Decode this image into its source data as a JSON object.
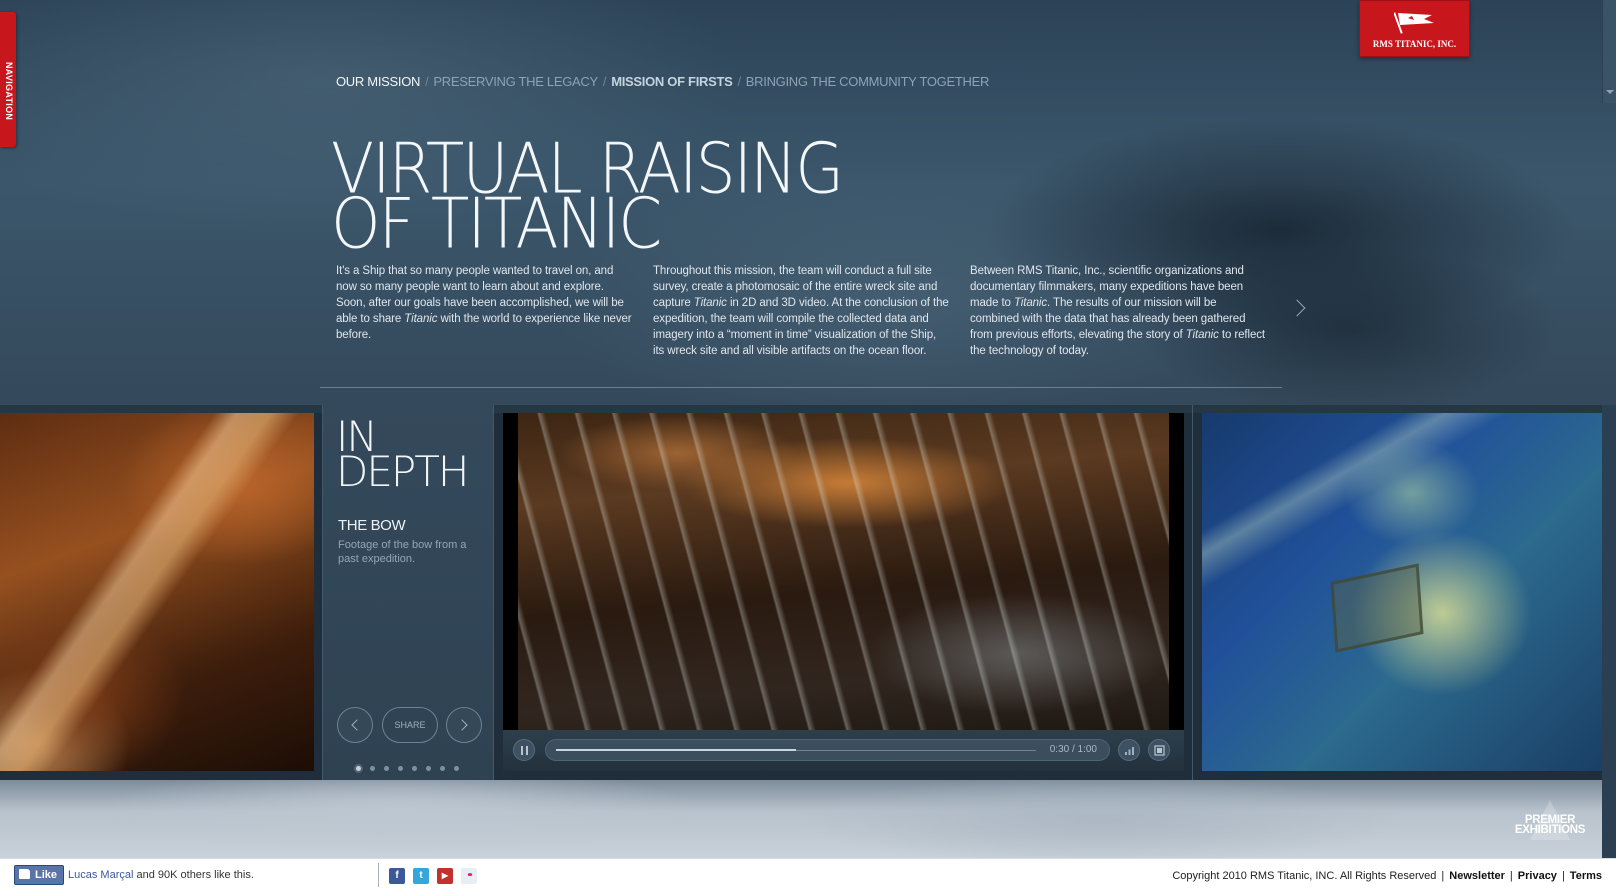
{
  "nav_tab": {
    "label": "NAVIGATION"
  },
  "logo": {
    "text": "RMS TITANIC, INC."
  },
  "breadcrumb": [
    {
      "label": "OUR MISSION"
    },
    {
      "label": "PRESERVING THE LEGACY"
    },
    {
      "label": "MISSION OF FIRSTS"
    },
    {
      "label": "BRINGING THE COMMUNITY TOGETHER"
    }
  ],
  "breadcrumb_separator": "/",
  "title": {
    "line1": "VIRTUAL RAISING",
    "line2": "OF TITANIC"
  },
  "columns": [
    {
      "pre": "It's a Ship that so many people wanted to travel on, and now so many people want to learn about and explore. Soon, after our goals have been accomplished, we will be able to share ",
      "em": "Titanic",
      "post": " with the world to experience like never before."
    },
    {
      "pre": "Throughout this mission, the team will conduct a full site survey, create a photomosaic of the entire wreck site and capture ",
      "em": "Titanic",
      "post": " in 2D and 3D video. At the conclusion of the expedition, the team will compile the collected data and imagery into a “moment in time” visualization of the Ship, its wreck site and all visible artifacts on the ocean floor."
    },
    {
      "pre": "Between RMS Titanic, Inc., scientific organizations and documentary filmmakers, many expeditions have been made to ",
      "em": "Titanic",
      "mid": ". The results of our mission will be combined with the data that has already been gathered from previous efforts, elevating the story of ",
      "em2": "Titanic",
      "post": " to reflect the technology of today."
    }
  ],
  "in_depth": {
    "title_line1": "IN",
    "title_line2": "DEPTH",
    "subtitle": "THE BOW",
    "description": "Footage of the bow from a past expedition.",
    "share_label": "SHARE",
    "dots_total": 8,
    "dots_active": 1
  },
  "video": {
    "time": "0:30 / 1:00",
    "progress": 0.5
  },
  "premier": {
    "line1": "PREMIER",
    "line2": "EXHIBITIONS"
  },
  "footer": {
    "like_label": "Like",
    "like_name": "Lucas Marçal",
    "like_rest": " and 90K others like this.",
    "social": [
      {
        "name": "facebook",
        "glyph": "f",
        "color": "#3b5998"
      },
      {
        "name": "twitter",
        "glyph": "t",
        "color": "#33a7dc"
      },
      {
        "name": "youtube",
        "glyph": "▶",
        "color": "#c4302b"
      },
      {
        "name": "flickr",
        "glyph": "••",
        "color": "#e8eef5"
      }
    ],
    "copyright": "Copyright 2010 RMS Titanic, INC. All Rights Reserved",
    "links": [
      "Newsletter",
      "Privacy",
      "Terms"
    ],
    "link_separator": "|"
  },
  "colors": {
    "brand_red": "#c8161d",
    "hero_text": "#f4f7f9",
    "link_blue": "#3b5998"
  }
}
